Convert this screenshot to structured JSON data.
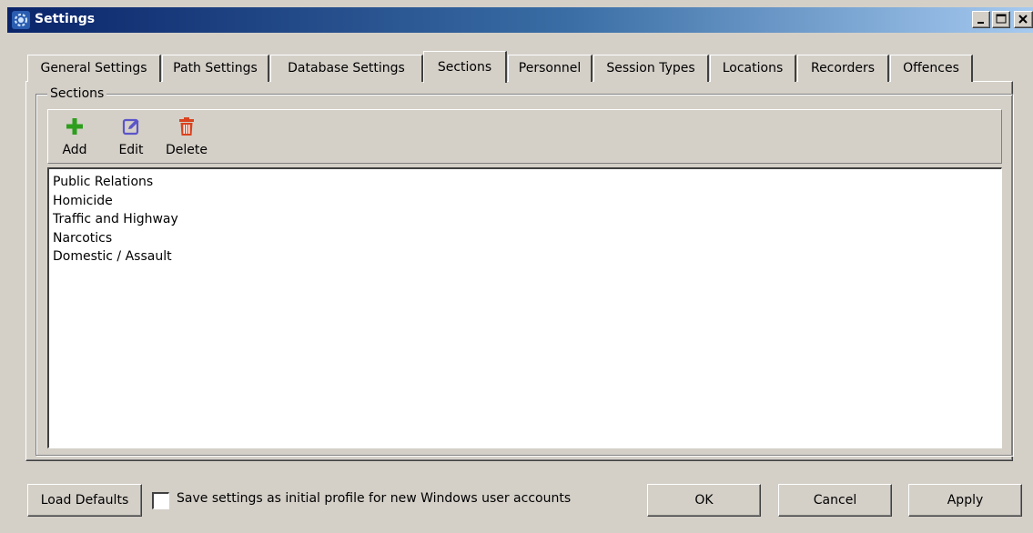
{
  "window": {
    "title": "Settings",
    "icon": "settings-gear-icon"
  },
  "tabs": [
    {
      "label": "General Settings",
      "active": false
    },
    {
      "label": "Path Settings",
      "active": false
    },
    {
      "label": "Database Settings",
      "active": false
    },
    {
      "label": "Sections",
      "active": true
    },
    {
      "label": "Personnel",
      "active": false
    },
    {
      "label": "Session Types",
      "active": false
    },
    {
      "label": "Locations",
      "active": false
    },
    {
      "label": "Recorders",
      "active": false
    },
    {
      "label": "Offences",
      "active": false
    }
  ],
  "group": {
    "label": "Sections"
  },
  "toolbar": {
    "add": {
      "label": "Add",
      "icon": "plus-icon",
      "color": "#2e9e1e"
    },
    "edit": {
      "label": "Edit",
      "icon": "edit-icon",
      "color": "#5b55c9"
    },
    "delete": {
      "label": "Delete",
      "icon": "trash-icon",
      "color": "#d9431e"
    }
  },
  "sections": [
    "Public Relations",
    "Homicide",
    "Traffic and Highway",
    "Narcotics",
    "Domestic / Assault"
  ],
  "footer": {
    "load_defaults": "Load Defaults",
    "save_profile_label": "Save settings as initial profile for new Windows user accounts",
    "save_profile_checked": false,
    "ok": "OK",
    "cancel": "Cancel",
    "apply": "Apply"
  }
}
